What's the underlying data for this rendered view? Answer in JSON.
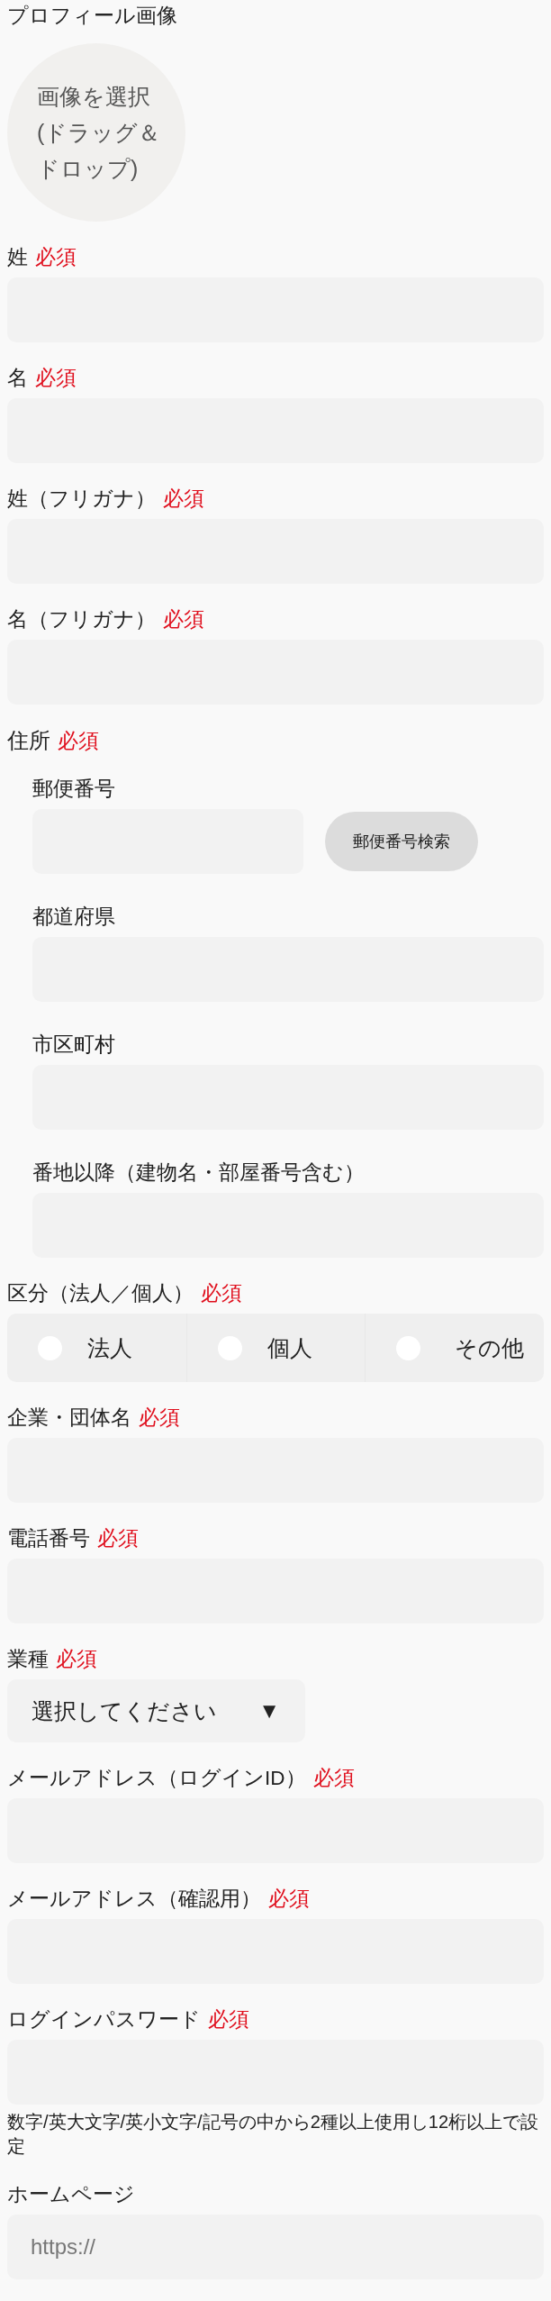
{
  "profile_image": {
    "label": "プロフィール画像",
    "button_lines": [
      "画像を選択",
      "(ドラッグ＆",
      "ドロップ)"
    ]
  },
  "fields": [
    {
      "kind": "text",
      "label": "姓",
      "badge": "必須"
    },
    {
      "kind": "text",
      "label": "名",
      "badge": "必須"
    },
    {
      "kind": "text",
      "label": "姓（フリガナ）",
      "badge": "必須"
    },
    {
      "kind": "text",
      "label": "名（フリガナ）",
      "badge": "必須"
    },
    {
      "kind": "group",
      "label": "住所",
      "badge": "必須",
      "children": [
        {
          "kind": "zip",
          "label": "郵便番号",
          "button": "郵便番号検索"
        },
        {
          "kind": "text",
          "label": "都道府県"
        },
        {
          "kind": "text",
          "label": "市区町村"
        },
        {
          "kind": "text",
          "label": "番地以降（建物名・部屋番号含む）"
        }
      ]
    },
    {
      "kind": "radio",
      "label": "区分（法人／個人）",
      "badge": "必須",
      "options": [
        {
          "label": "法人",
          "selected": false
        },
        {
          "label": "個人",
          "selected": false
        },
        {
          "label": "その他",
          "selected": false
        }
      ]
    },
    {
      "kind": "text",
      "label": "企業・団体名",
      "badge": "必須"
    },
    {
      "kind": "text",
      "label": "電話番号",
      "badge": "必須"
    },
    {
      "kind": "select",
      "label": "業種",
      "badge": "必須",
      "value": "選択してください",
      "caret": "▼"
    },
    {
      "kind": "text",
      "label": "メールアドレス（ログインID）",
      "badge": "必須"
    },
    {
      "kind": "text",
      "label": "メールアドレス（確認用）",
      "badge": "必須"
    },
    {
      "kind": "text",
      "label": "ログインパスワード",
      "badge": "必須",
      "hint": "数字/英大文字/英小文字/記号の中から2種以上使用し12桁以上で設定"
    },
    {
      "kind": "text",
      "label": "ホームページ",
      "placeholder": "https://"
    }
  ]
}
